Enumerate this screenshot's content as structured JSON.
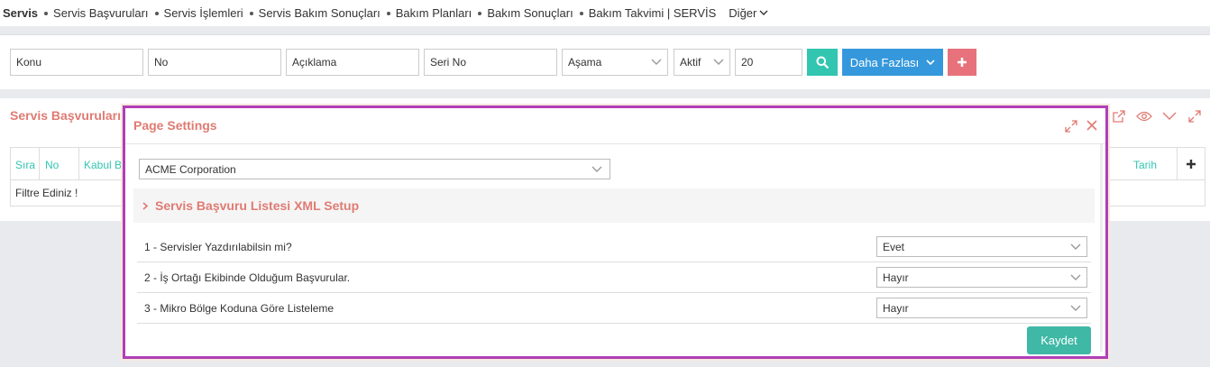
{
  "topnav": {
    "brand": "Servis",
    "items": [
      "Servis Başvuruları",
      "Servis İşlemleri",
      "Servis Bakım Sonuçları",
      "Bakım Planları",
      "Bakım Sonuçları",
      "Bakım Takvimi | SERVİS"
    ],
    "more": "Diğer"
  },
  "filters": {
    "konu": "Konu",
    "no": "No",
    "aciklama": "Açıklama",
    "seri_no": "Seri No",
    "asama": "Aşama",
    "aktif": "Aktif",
    "count": "20",
    "more_button": "Daha Fazlası"
  },
  "portlet": {
    "title": "Servis Başvuruları",
    "columns": [
      "Sıra",
      "No",
      "Kabul Be",
      "Tarih"
    ],
    "empty_message": "Filtre Ediniz !"
  },
  "modal": {
    "title": "Page Settings",
    "company": "ACME Corporation",
    "section_title": "Servis Başvuru Listesi XML Setup",
    "settings": [
      {
        "label": "1 - Servisler Yazdırılabilsin mi?",
        "value": "Evet"
      },
      {
        "label": "2 - İş Ortağı Ekibinde Olduğum Başvurular.",
        "value": "Hayır"
      },
      {
        "label": "3 - Mikro Bölge Koduna Göre Listeleme",
        "value": "Hayır"
      }
    ],
    "save_button": "Kaydet"
  },
  "colors": {
    "accent_teal": "#32c5b0",
    "accent_blue": "#3598dc",
    "accent_red": "#e7727b",
    "title_color": "#e07b73",
    "modal_border": "#b03fb8"
  }
}
